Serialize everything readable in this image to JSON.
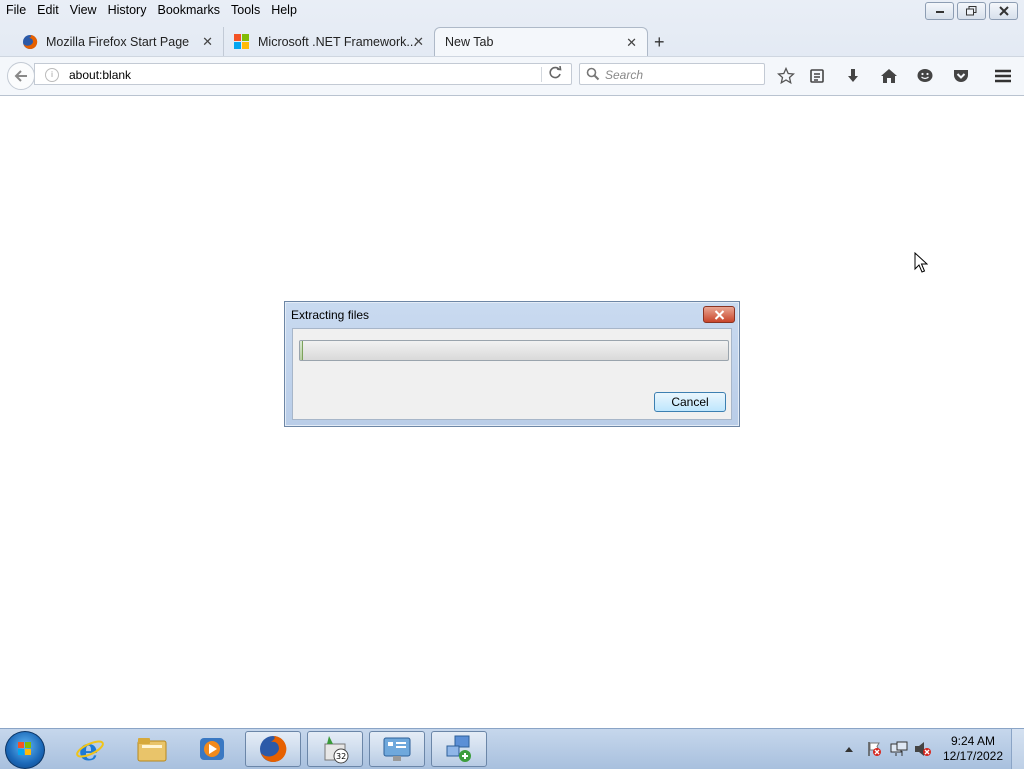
{
  "menu": [
    "File",
    "Edit",
    "View",
    "History",
    "Bookmarks",
    "Tools",
    "Help"
  ],
  "tabs": [
    {
      "label": "Mozilla Firefox Start Page",
      "icon": "firefox-icon"
    },
    {
      "label": "Microsoft .NET Framework...",
      "icon": "microsoft-logo-icon"
    },
    {
      "label": "New Tab",
      "icon": "",
      "active": true
    }
  ],
  "navbar": {
    "url": "about:blank",
    "search_placeholder": "Search"
  },
  "dialog": {
    "title": "Extracting files",
    "cancel_label": "Cancel",
    "progress": 0
  },
  "taskbar": {
    "apps": [
      "internet-explorer-icon",
      "file-explorer-icon",
      "media-player-icon",
      "firefox-icon",
      "installer-32-icon",
      "control-panel-icon",
      "network-setup-icon"
    ],
    "time": "9:24 AM",
    "date": "12/17/2022"
  },
  "colors": {
    "titlebar": "#c9daf0",
    "accent": "#3c7fb1",
    "close_red": "#c9452a",
    "taskbar": "#b4c9e4"
  }
}
